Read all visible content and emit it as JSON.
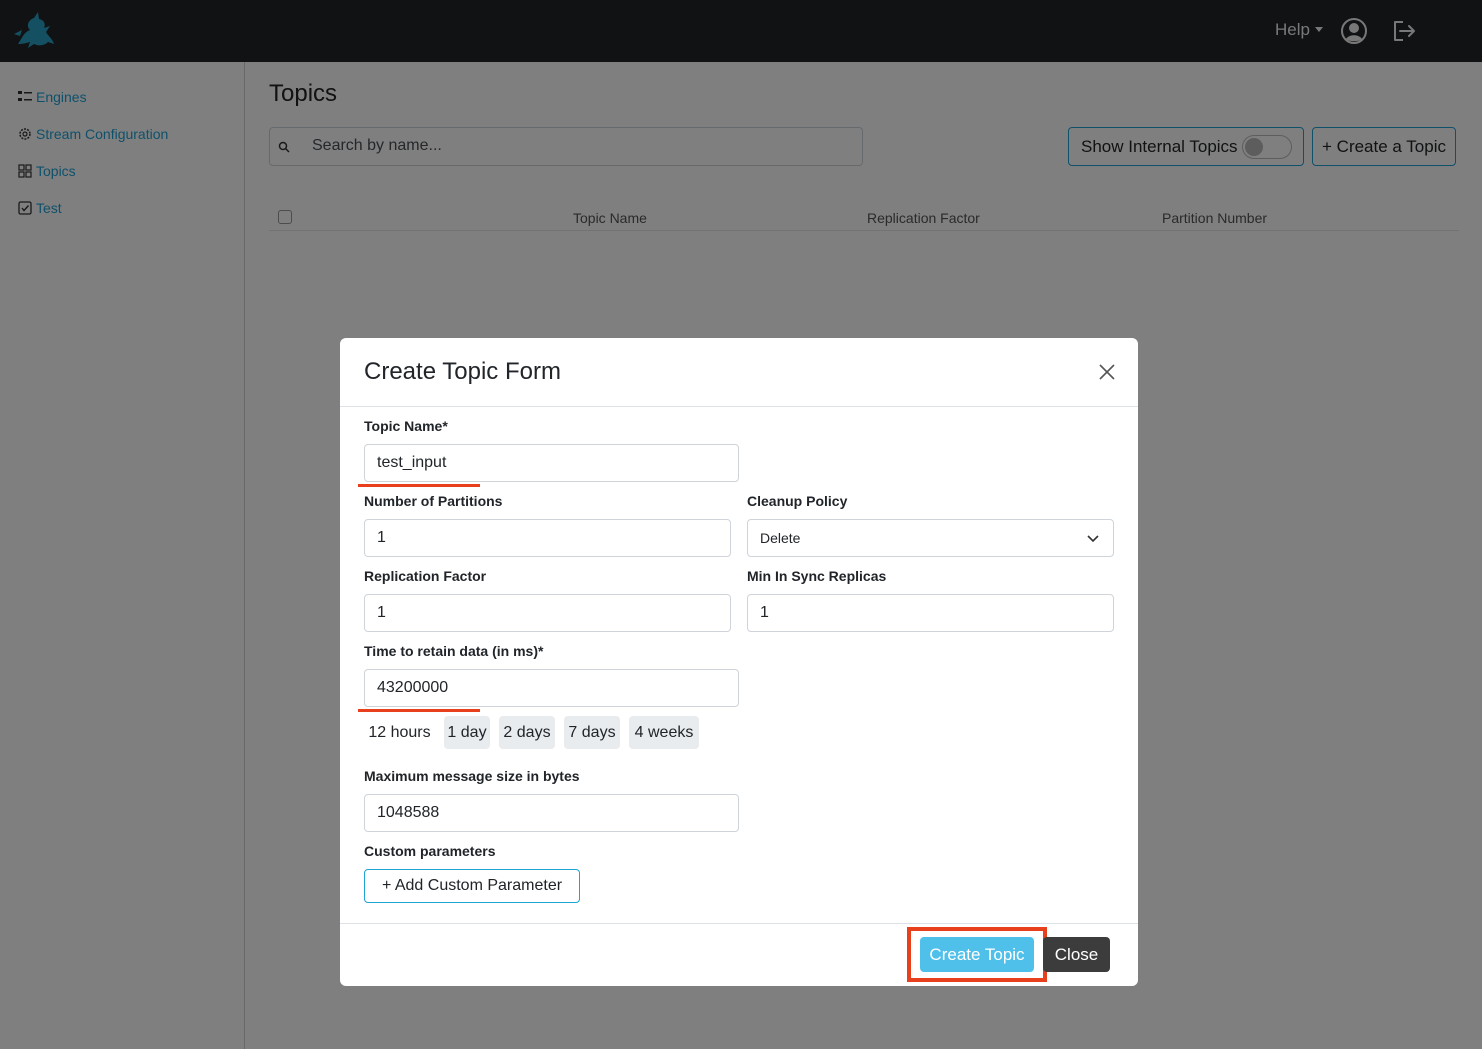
{
  "navbar": {
    "help_label": "Help"
  },
  "sidebar": {
    "items": [
      {
        "label": "Engines",
        "icon": "list-icon"
      },
      {
        "label": "Stream Configuration",
        "icon": "gear-icon"
      },
      {
        "label": "Topics",
        "icon": "grid-icon"
      },
      {
        "label": "Test",
        "icon": "checkbox-icon"
      }
    ]
  },
  "main": {
    "title": "Topics",
    "search_placeholder": "Search by name...",
    "show_internal_label": "Show Internal Topics",
    "show_internal_on": false,
    "create_topic_label": "+ Create a Topic",
    "table_headers": [
      "Topic Name",
      "Replication Factor",
      "Partition Number"
    ]
  },
  "modal": {
    "title": "Create Topic Form",
    "topic_name": {
      "label": "Topic Name*",
      "value": "test_input"
    },
    "partitions": {
      "label": "Number of Partitions",
      "value": "1"
    },
    "cleanup_policy": {
      "label": "Cleanup Policy",
      "value": "Delete"
    },
    "replication_factor": {
      "label": "Replication Factor",
      "value": "1"
    },
    "min_in_sync": {
      "label": "Min In Sync Replicas",
      "value": "1"
    },
    "retention": {
      "label": "Time to retain data (in ms)*",
      "value": "43200000"
    },
    "retention_presets": [
      "12 hours",
      "1 day",
      "2 days",
      "7 days",
      "4 weeks"
    ],
    "max_message": {
      "label": "Maximum message size in bytes",
      "value": "1048588"
    },
    "custom_params": {
      "label": "Custom parameters",
      "add_label": "+ Add Custom Parameter"
    },
    "submit_label": "Create Topic",
    "close_label": "Close"
  },
  "colors": {
    "accent": "#1fa2d6",
    "annotation": "#e8401c",
    "navbar": "#212529"
  }
}
